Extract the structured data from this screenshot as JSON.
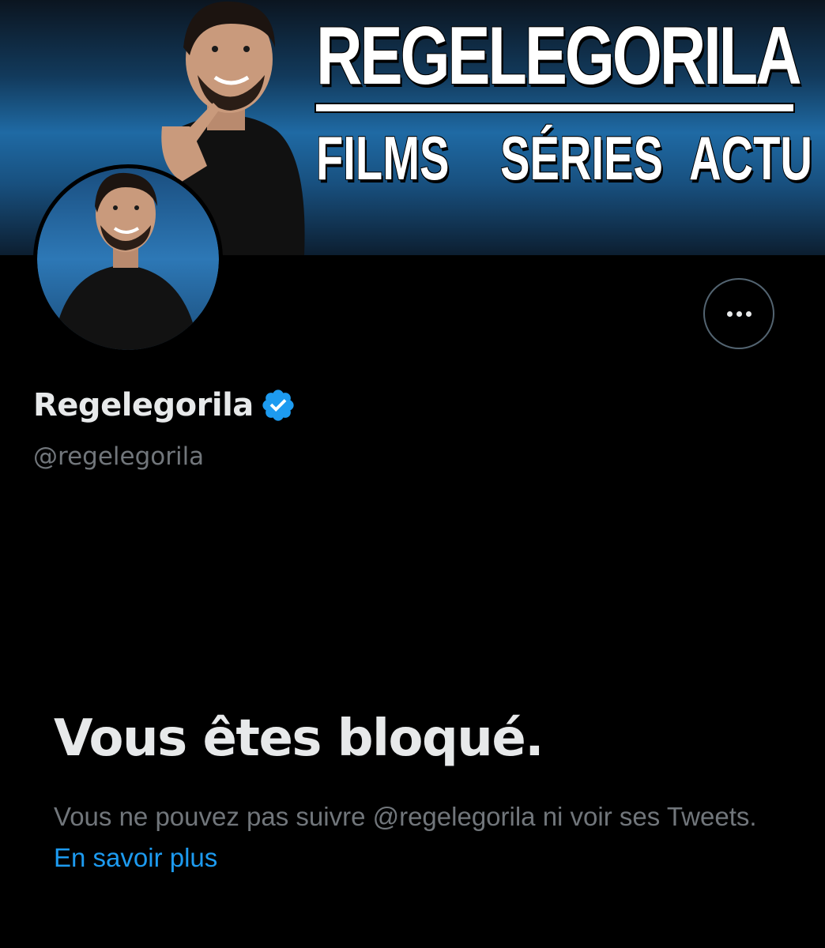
{
  "banner": {
    "title": "REGELEGORILA",
    "subtitles": [
      "FILMS",
      "SÉRIES",
      "ACTU"
    ]
  },
  "profile": {
    "display_name": "Regelegorila",
    "handle": "@regelegorila",
    "verified": true,
    "verified_color": "#1d9bf0",
    "more_icon": "more-horizontal-icon"
  },
  "blocked": {
    "title": "Vous êtes bloqué.",
    "description": "Vous ne pouvez pas suivre @regelegorila ni voir ses Tweets.",
    "learn_more": "En savoir plus",
    "link_color": "#1d9bf0"
  }
}
